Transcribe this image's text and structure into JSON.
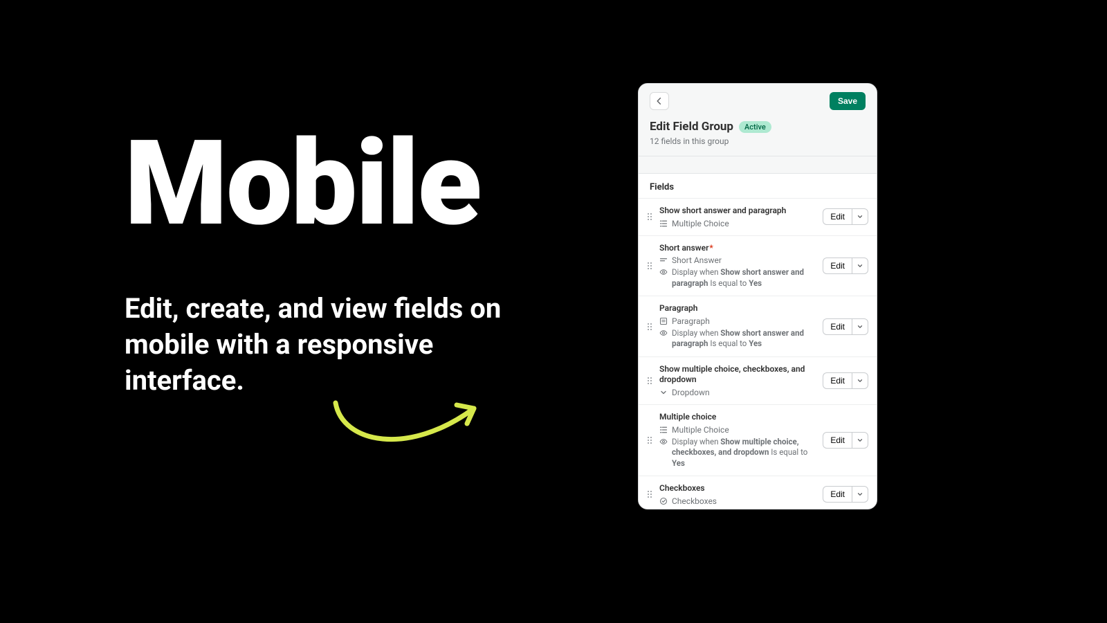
{
  "hero": {
    "title": "Mobile",
    "subtitle": "Edit, create, and view fields on mobile with a responsive interface."
  },
  "header": {
    "save_label": "Save",
    "title": "Edit Field Group",
    "badge": "Active",
    "subtitle": "12 fields in this group"
  },
  "section_title": "Fields",
  "cond_prefix": "Display when ",
  "cond_op": " Is equal to ",
  "edit_label": "Edit",
  "fields": [
    {
      "name": "Show short answer and paragraph",
      "type": "Multiple Choice",
      "required": false
    },
    {
      "name": "Short answer",
      "type": "Short Answer",
      "required": true,
      "cond_field": "Show short answer and paragraph",
      "cond_value": "Yes"
    },
    {
      "name": "Paragraph",
      "type": "Paragraph",
      "required": false,
      "cond_field": "Show short answer and paragraph",
      "cond_value": "Yes"
    },
    {
      "name": "Show multiple choice, checkboxes, and dropdown",
      "type": "Dropdown",
      "required": false
    },
    {
      "name": "Multiple choice",
      "type": "Multiple Choice",
      "required": false,
      "cond_field": "Show multiple choice, checkboxes, and dropdown",
      "cond_value": "Yes"
    },
    {
      "name": "Checkboxes",
      "type": "Checkboxes",
      "required": false
    }
  ]
}
